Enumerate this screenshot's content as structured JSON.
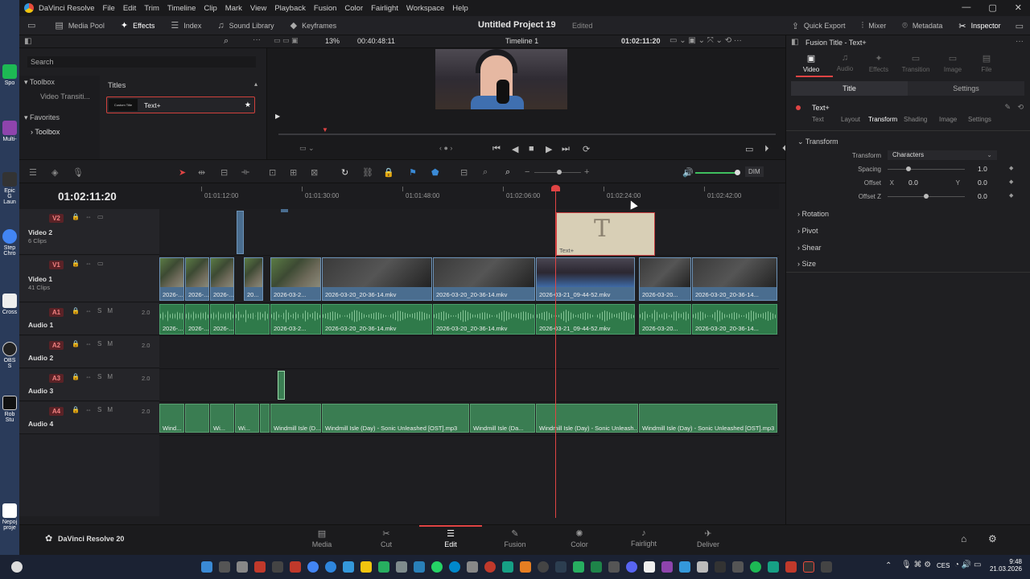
{
  "app": {
    "menu": [
      "DaVinci Resolve",
      "File",
      "Edit",
      "Trim",
      "Timeline",
      "Clip",
      "Mark",
      "View",
      "Playback",
      "Fusion",
      "Color",
      "Fairlight",
      "Workspace",
      "Help"
    ],
    "window_buttons": [
      "—",
      "▢",
      "✕"
    ]
  },
  "desktop": {
    "icons": [
      {
        "label": "Spo",
        "color": "#1db954"
      },
      {
        "label": "Multi-",
        "color": "#8e44ad"
      },
      {
        "label": "Epic G Laun",
        "color": "#333333"
      },
      {
        "label": "Step Chro",
        "color": "#4285f4"
      },
      {
        "label": "Cross",
        "color": "#eeeeee"
      },
      {
        "label": "OBS S",
        "color": "#222222"
      },
      {
        "label": "Rob Stu",
        "color": "#111111"
      },
      {
        "label": "Nepoj proje",
        "color": "#ffffff"
      }
    ]
  },
  "toolbar": {
    "media_pool": "Media Pool",
    "effects": "Effects",
    "index": "Index",
    "sound_library": "Sound Library",
    "keyframes": "Keyframes",
    "project_title": "Untitled Project 19",
    "edited": "Edited",
    "quick_export": "Quick Export",
    "mixer": "Mixer",
    "metadata": "Metadata",
    "inspector": "Inspector"
  },
  "viewer_bar": {
    "zoom": "13%",
    "duration": "00:40:48:11",
    "timeline_name": "Timeline 1",
    "timecode": "01:02:11:20"
  },
  "effects_panel": {
    "search_placeholder": "Search",
    "tree": {
      "toolbox": "Toolbox",
      "video_transitions": "Video Transiti...",
      "favorites": "Favorites",
      "toolbox2": "Toolbox"
    },
    "titles_header": "Titles",
    "item_thumb": "Custom Title",
    "item_label": "Text+"
  },
  "timeline": {
    "timecode": "01:02:11:20",
    "ruler": [
      "01:01:12:00",
      "01:01:30:00",
      "01:01:48:00",
      "01:02:06:00",
      "01:02:24:00",
      "01:02:42:00"
    ],
    "tracks": {
      "v2": {
        "tag": "V2",
        "name": "Video 2",
        "sub": "6 Clips"
      },
      "v1": {
        "tag": "V1",
        "name": "Video 1",
        "sub": "41 Clips"
      },
      "a1": {
        "tag": "A1",
        "name": "Audio 1",
        "vol": "2.0"
      },
      "a2": {
        "tag": "A2",
        "name": "Audio 2",
        "vol": "2.0"
      },
      "a3": {
        "tag": "A3",
        "name": "Audio 3",
        "vol": "2.0"
      },
      "a4": {
        "tag": "A4",
        "name": "Audio 4",
        "vol": "2.0"
      }
    },
    "v1_clips": [
      "2026-...",
      "2026-...",
      "2026-...",
      "20...",
      "2026-03-2...",
      "2026-03-20_20-36-14.mkv",
      "2026-03-20_20-36-14.mkv",
      "2026-03-21_09-44-52.mkv",
      "2026-03-20...",
      "2026-03-20_20-36-14..."
    ],
    "a1_clips": [
      "2026-...",
      "2026-...",
      "2026-...",
      "2026-03-2...",
      "2026-03-20_20-36-14.mkv",
      "2026-03-20_20-36-14.mkv",
      "2026-03-21_09-44-52.mkv",
      "2026-03-20...",
      "2026-03-20_20-36-14..."
    ],
    "a4_clips": [
      "Wind...",
      "Wi...",
      "Wi...",
      "Windmill Isle (D...",
      "Windmill Isle (Day) - Sonic Unleashed [OST].mp3",
      "Windmill Isle (Da...",
      "Windmill Isle (Day) - Sonic Unleash...",
      "Windmill Isle (Day) - Sonic Unleashed [OST].mp3"
    ],
    "title_clip_label": "Text+",
    "title_glyph": "T",
    "dim": "DIM"
  },
  "pages": [
    "Media",
    "Cut",
    "Edit",
    "Fusion",
    "Color",
    "Fairlight",
    "Deliver"
  ],
  "brand": "DaVinci Resolve 20",
  "inspector": {
    "header": "Fusion Title - Text+",
    "tabs": [
      "Video",
      "Audio",
      "Effects",
      "Transition",
      "Image",
      "File"
    ],
    "title_tab": "Title",
    "settings_tab": "Settings",
    "node": "Text+",
    "subtabs": [
      "Text",
      "Layout",
      "Transform",
      "Shading",
      "Image",
      "Settings"
    ],
    "transform_section": "Transform",
    "transform_label": "Transform",
    "transform_value": "Characters",
    "spacing_label": "Spacing",
    "spacing_value": "1.0",
    "offset_label": "Offset",
    "offset_x_label": "X",
    "offset_x": "0.0",
    "offset_y_label": "Y",
    "offset_y": "0.0",
    "offsetz_label": "Offset Z",
    "offsetz_value": "0.0",
    "sections": [
      "Rotation",
      "Pivot",
      "Shear",
      "Size"
    ]
  },
  "tray": {
    "lang": "CES",
    "time": "9:48",
    "date": "21.03.2026"
  }
}
